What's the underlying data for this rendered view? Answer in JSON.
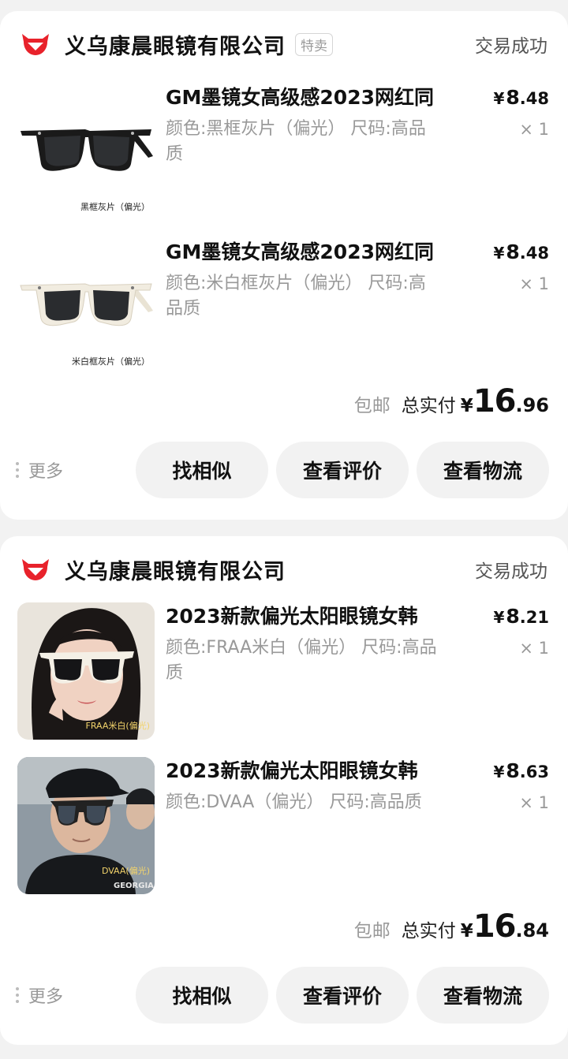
{
  "orders": [
    {
      "shop_name": "义乌康晨眼镜有限公司",
      "tag": "特卖",
      "status": "交易成功",
      "items": [
        {
          "title": "GM墨镜女高级感2023网红同",
          "spec": "颜色:黑框灰片（偏光） 尺码:高品质",
          "price_yen": "¥",
          "price_int": "8",
          "price_dec": ".48",
          "qty": "× 1",
          "thumb_caption": "黑框灰片（偏光）",
          "frame_color": "#1a1a1a"
        },
        {
          "title": "GM墨镜女高级感2023网红同",
          "spec": "颜色:米白框灰片（偏光） 尺码:高品质",
          "price_yen": "¥",
          "price_int": "8",
          "price_dec": ".48",
          "qty": "× 1",
          "thumb_caption": "米白框灰片（偏光）",
          "frame_color": "#f1ece0"
        }
      ],
      "shipping": "包邮",
      "total_label": "总实付",
      "total_yen": "¥",
      "total_int": "16",
      "total_dec": ".96",
      "more": "更多",
      "buttons": [
        "找相似",
        "查看评价",
        "查看物流"
      ]
    },
    {
      "shop_name": "义乌康晨眼镜有限公司",
      "status": "交易成功",
      "items": [
        {
          "title": "2023新款偏光太阳眼镜女韩",
          "spec": "颜色:FRAA米白（偏光） 尺码:高品质",
          "price_yen": "¥",
          "price_int": "8",
          "price_dec": ".21",
          "qty": "× 1",
          "thumb_caption": "FRAA米白(偏光)"
        },
        {
          "title": "2023新款偏光太阳眼镜女韩",
          "spec": "颜色:DVAA（偏光） 尺码:高品质",
          "price_yen": "¥",
          "price_int": "8",
          "price_dec": ".63",
          "qty": "× 1",
          "thumb_caption": "DVAA(偏光)"
        }
      ],
      "shipping": "包邮",
      "total_label": "总实付",
      "total_yen": "¥",
      "total_int": "16",
      "total_dec": ".84",
      "more": "更多",
      "buttons": [
        "找相似",
        "查看评价",
        "查看物流"
      ]
    }
  ],
  "colors": {
    "brand_red": "#e8222b",
    "background": "#f2f2f2",
    "muted_text": "#999999"
  }
}
